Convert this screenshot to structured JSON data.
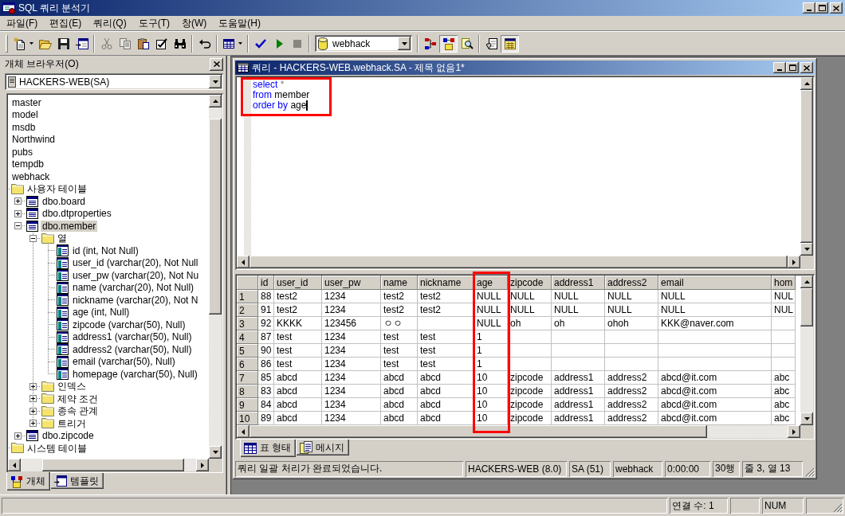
{
  "window": {
    "title": "SQL 쿼리 분석기"
  },
  "menu": [
    "파일(F)",
    "편집(E)",
    "쿼리(Q)",
    "도구(T)",
    "창(W)",
    "도움말(H)"
  ],
  "toolbar": {
    "groups_before": [
      [
        {
          "kind": "new",
          "disabled": false,
          "pressed": false
        },
        {
          "kind": "open",
          "disabled": false,
          "pressed": false
        },
        {
          "kind": "save",
          "disabled": false,
          "pressed": false
        },
        {
          "kind": "template",
          "disabled": false,
          "pressed": false
        }
      ],
      [
        {
          "kind": "cut",
          "disabled": true,
          "pressed": false
        },
        {
          "kind": "copy",
          "disabled": true,
          "pressed": false
        },
        {
          "kind": "paste",
          "disabled": false,
          "pressed": false
        },
        {
          "kind": "edit",
          "disabled": false,
          "pressed": false
        },
        {
          "kind": "find",
          "disabled": false,
          "pressed": false
        }
      ],
      [
        {
          "kind": "undo",
          "disabled": false,
          "pressed": false
        }
      ],
      [
        {
          "kind": "grid",
          "disabled": false,
          "pressed": false
        }
      ],
      [
        {
          "kind": "parse",
          "disabled": false,
          "pressed": false
        },
        {
          "kind": "execute",
          "disabled": false,
          "pressed": false
        },
        {
          "kind": "stop",
          "disabled": true,
          "pressed": false
        }
      ]
    ],
    "database": "webhack",
    "groups_after": [
      [
        {
          "kind": "plan",
          "disabled": false,
          "pressed": false
        },
        {
          "kind": "browser",
          "disabled": false,
          "pressed": true
        },
        {
          "kind": "tuning",
          "disabled": false,
          "pressed": false
        }
      ],
      [
        {
          "kind": "properties",
          "disabled": false,
          "pressed": false
        },
        {
          "kind": "results",
          "disabled": false,
          "pressed": true
        }
      ]
    ]
  },
  "object_browser": {
    "title": "개체 브라우저(O)",
    "server": "HACKERS-WEB(SA)",
    "tree": [
      {
        "label": "master",
        "selected": false
      },
      {
        "label": "model",
        "selected": false
      },
      {
        "label": "msdb",
        "selected": false
      },
      {
        "label": "Northwind",
        "selected": false
      },
      {
        "label": "pubs",
        "selected": false
      },
      {
        "label": "tempdb",
        "selected": false
      },
      {
        "label": "webhack",
        "selected": false,
        "children": [
          {
            "label": "사용자 테이블",
            "kind": "folder",
            "selected": false,
            "children": [
              {
                "label": "dbo.board",
                "kind": "table",
                "selected": false,
                "expanded": false
              },
              {
                "label": "dbo.dtproperties",
                "kind": "table",
                "selected": false,
                "expanded": false
              },
              {
                "label": "dbo.member",
                "kind": "table",
                "selected": true,
                "expanded": true,
                "children": [
                  {
                    "label": "열",
                    "kind": "folder",
                    "selected": false,
                    "expanded": true,
                    "children": [
                      {
                        "label": "id (int, Not Null)",
                        "kind": "column",
                        "selected": false
                      },
                      {
                        "label": "user_id (varchar(20), Not Null",
                        "kind": "column",
                        "selected": false
                      },
                      {
                        "label": "user_pw (varchar(20), Not Nu",
                        "kind": "column",
                        "selected": false
                      },
                      {
                        "label": "name (varchar(20), Not Null)",
                        "kind": "column",
                        "selected": false
                      },
                      {
                        "label": "nickname (varchar(20), Not N",
                        "kind": "column",
                        "selected": false
                      },
                      {
                        "label": "age (int, Null)",
                        "kind": "column",
                        "selected": false
                      },
                      {
                        "label": "zipcode (varchar(50), Null)",
                        "kind": "column",
                        "selected": false
                      },
                      {
                        "label": "address1 (varchar(50), Null)",
                        "kind": "column",
                        "selected": false
                      },
                      {
                        "label": "address2 (varchar(50), Null)",
                        "kind": "column",
                        "selected": false
                      },
                      {
                        "label": "email (varchar(50), Null)",
                        "kind": "column",
                        "selected": false
                      },
                      {
                        "label": "homepage (varchar(50), Null)",
                        "kind": "column",
                        "selected": false
                      }
                    ]
                  },
                  {
                    "label": "인덱스",
                    "kind": "folder",
                    "selected": false,
                    "expanded": false
                  },
                  {
                    "label": "제약 조건",
                    "kind": "folder",
                    "selected": false,
                    "expanded": false
                  },
                  {
                    "label": "종속 관계",
                    "kind": "folder",
                    "selected": false,
                    "expanded": false
                  },
                  {
                    "label": "트리거",
                    "kind": "folder",
                    "selected": false,
                    "expanded": false
                  }
                ]
              },
              {
                "label": "dbo.zipcode",
                "kind": "table",
                "selected": false,
                "expanded": false
              }
            ]
          },
          {
            "label": "시스템 테이블",
            "kind": "folder",
            "selected": false
          }
        ]
      }
    ],
    "tabs": [
      {
        "label": "개체",
        "kind": "objects",
        "selected": true
      },
      {
        "label": "템플릿",
        "kind": "templates",
        "selected": false
      }
    ]
  },
  "query_window": {
    "title": "쿼리 - HACKERS-WEB.webhack.SA - 제목 없음1*",
    "editor": {
      "highlighted": true,
      "lines": [
        {
          "tokens": [
            {
              "text": "select",
              "kind": "keyword"
            },
            {
              "text": "*",
              "kind": "operator"
            }
          ],
          "caret": false
        },
        {
          "tokens": [
            {
              "text": "from",
              "kind": "keyword"
            },
            {
              "text": "member",
              "kind": "identifier"
            }
          ],
          "caret": false
        },
        {
          "tokens": [
            {
              "text": "order by",
              "kind": "keyword"
            },
            {
              "text": "age",
              "kind": "identifier"
            }
          ],
          "caret": true
        }
      ]
    },
    "results": {
      "columns": [
        {
          "label": "id",
          "highlighted": false
        },
        {
          "label": "user_id",
          "highlighted": false
        },
        {
          "label": "user_pw",
          "highlighted": false
        },
        {
          "label": "name",
          "highlighted": false
        },
        {
          "label": "nickname",
          "highlighted": false
        },
        {
          "label": "age",
          "highlighted": true
        },
        {
          "label": "zipcode",
          "highlighted": false
        },
        {
          "label": "address1",
          "highlighted": false
        },
        {
          "label": "address2",
          "highlighted": false
        },
        {
          "label": "email",
          "highlighted": false
        },
        {
          "label": "hom",
          "highlighted": false
        }
      ],
      "rows": [
        {
          "number": "1",
          "cells": [
            "88",
            "test2",
            "1234",
            "test2",
            "test2",
            "NULL",
            "NULL",
            "NULL",
            "NULL",
            "NULL",
            "NUL"
          ]
        },
        {
          "number": "2",
          "cells": [
            "91",
            "test2",
            "1234",
            "test2",
            "test2",
            "NULL",
            "NULL",
            "NULL",
            "NULL",
            "NULL",
            "NUL"
          ]
        },
        {
          "number": "3",
          "cells": [
            "92",
            "KKKK",
            "123456",
            "ㅇㅇ",
            null,
            "NULL",
            "oh",
            "oh",
            "ohoh",
            "KKK@naver.com",
            null
          ]
        },
        {
          "number": "4",
          "cells": [
            "87",
            "test",
            "1234",
            "test",
            "test",
            "1",
            null,
            null,
            null,
            null,
            null
          ]
        },
        {
          "number": "5",
          "cells": [
            "90",
            "test",
            "1234",
            "test",
            "test",
            "1",
            null,
            null,
            null,
            null,
            null
          ]
        },
        {
          "number": "6",
          "cells": [
            "86",
            "test",
            "1234",
            "test",
            "test",
            "1",
            null,
            null,
            null,
            null,
            null
          ]
        },
        {
          "number": "7",
          "cells": [
            "85",
            "abcd",
            "1234",
            "abcd",
            "abcd",
            "10",
            "zipcode",
            "address1",
            "address2",
            "abcd@it.com",
            "abc"
          ]
        },
        {
          "number": "8",
          "cells": [
            "83",
            "abcd",
            "1234",
            "abcd",
            "abcd",
            "10",
            "zipcode",
            "address1",
            "address2",
            "abcd@it.com",
            "abc"
          ]
        },
        {
          "number": "9",
          "cells": [
            "84",
            "abcd",
            "1234",
            "abcd",
            "abcd",
            "10",
            "zipcode",
            "address1",
            "address2",
            "abcd@it.com",
            "abc"
          ]
        },
        {
          "number": "10",
          "cells": [
            "89",
            "abcd",
            "1234",
            "abcd",
            "abcd",
            "10",
            "zipcode",
            "address1",
            "address2",
            "abcd@it.com",
            "abc"
          ]
        }
      ]
    },
    "tabs": [
      {
        "label": "표 형태",
        "kind": "grid",
        "selected": true
      },
      {
        "label": "메시지",
        "kind": "messages",
        "selected": false
      }
    ],
    "status": [
      "쿼리 일괄 처리가 완료되었습니다.",
      "HACKERS-WEB (8.0)",
      "SA (51)",
      "webhack",
      "0:00:00",
      "30행",
      "줄 3, 열 13"
    ]
  },
  "status_bar": [
    "연결 수: 1",
    "NUM"
  ]
}
